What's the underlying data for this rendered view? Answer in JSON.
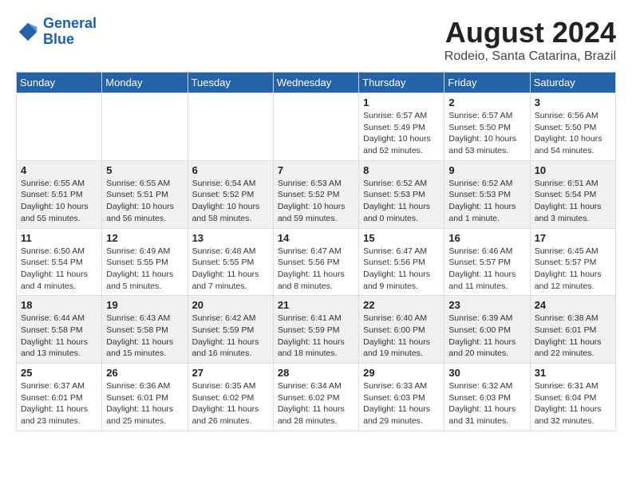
{
  "header": {
    "logo_line1": "General",
    "logo_line2": "Blue",
    "month_year": "August 2024",
    "location": "Rodeio, Santa Catarina, Brazil"
  },
  "weekdays": [
    "Sunday",
    "Monday",
    "Tuesday",
    "Wednesday",
    "Thursday",
    "Friday",
    "Saturday"
  ],
  "weeks": [
    [
      {
        "day": "",
        "sunrise": "",
        "sunset": "",
        "daylight": ""
      },
      {
        "day": "",
        "sunrise": "",
        "sunset": "",
        "daylight": ""
      },
      {
        "day": "",
        "sunrise": "",
        "sunset": "",
        "daylight": ""
      },
      {
        "day": "",
        "sunrise": "",
        "sunset": "",
        "daylight": ""
      },
      {
        "day": "1",
        "sunrise": "Sunrise: 6:57 AM",
        "sunset": "Sunset: 5:49 PM",
        "daylight": "Daylight: 10 hours and 52 minutes."
      },
      {
        "day": "2",
        "sunrise": "Sunrise: 6:57 AM",
        "sunset": "Sunset: 5:50 PM",
        "daylight": "Daylight: 10 hours and 53 minutes."
      },
      {
        "day": "3",
        "sunrise": "Sunrise: 6:56 AM",
        "sunset": "Sunset: 5:50 PM",
        "daylight": "Daylight: 10 hours and 54 minutes."
      }
    ],
    [
      {
        "day": "4",
        "sunrise": "Sunrise: 6:55 AM",
        "sunset": "Sunset: 5:51 PM",
        "daylight": "Daylight: 10 hours and 55 minutes."
      },
      {
        "day": "5",
        "sunrise": "Sunrise: 6:55 AM",
        "sunset": "Sunset: 5:51 PM",
        "daylight": "Daylight: 10 hours and 56 minutes."
      },
      {
        "day": "6",
        "sunrise": "Sunrise: 6:54 AM",
        "sunset": "Sunset: 5:52 PM",
        "daylight": "Daylight: 10 hours and 58 minutes."
      },
      {
        "day": "7",
        "sunrise": "Sunrise: 6:53 AM",
        "sunset": "Sunset: 5:52 PM",
        "daylight": "Daylight: 10 hours and 59 minutes."
      },
      {
        "day": "8",
        "sunrise": "Sunrise: 6:52 AM",
        "sunset": "Sunset: 5:53 PM",
        "daylight": "Daylight: 11 hours and 0 minutes."
      },
      {
        "day": "9",
        "sunrise": "Sunrise: 6:52 AM",
        "sunset": "Sunset: 5:53 PM",
        "daylight": "Daylight: 11 hours and 1 minute."
      },
      {
        "day": "10",
        "sunrise": "Sunrise: 6:51 AM",
        "sunset": "Sunset: 5:54 PM",
        "daylight": "Daylight: 11 hours and 3 minutes."
      }
    ],
    [
      {
        "day": "11",
        "sunrise": "Sunrise: 6:50 AM",
        "sunset": "Sunset: 5:54 PM",
        "daylight": "Daylight: 11 hours and 4 minutes."
      },
      {
        "day": "12",
        "sunrise": "Sunrise: 6:49 AM",
        "sunset": "Sunset: 5:55 PM",
        "daylight": "Daylight: 11 hours and 5 minutes."
      },
      {
        "day": "13",
        "sunrise": "Sunrise: 6:48 AM",
        "sunset": "Sunset: 5:55 PM",
        "daylight": "Daylight: 11 hours and 7 minutes."
      },
      {
        "day": "14",
        "sunrise": "Sunrise: 6:47 AM",
        "sunset": "Sunset: 5:56 PM",
        "daylight": "Daylight: 11 hours and 8 minutes."
      },
      {
        "day": "15",
        "sunrise": "Sunrise: 6:47 AM",
        "sunset": "Sunset: 5:56 PM",
        "daylight": "Daylight: 11 hours and 9 minutes."
      },
      {
        "day": "16",
        "sunrise": "Sunrise: 6:46 AM",
        "sunset": "Sunset: 5:57 PM",
        "daylight": "Daylight: 11 hours and 11 minutes."
      },
      {
        "day": "17",
        "sunrise": "Sunrise: 6:45 AM",
        "sunset": "Sunset: 5:57 PM",
        "daylight": "Daylight: 11 hours and 12 minutes."
      }
    ],
    [
      {
        "day": "18",
        "sunrise": "Sunrise: 6:44 AM",
        "sunset": "Sunset: 5:58 PM",
        "daylight": "Daylight: 11 hours and 13 minutes."
      },
      {
        "day": "19",
        "sunrise": "Sunrise: 6:43 AM",
        "sunset": "Sunset: 5:58 PM",
        "daylight": "Daylight: 11 hours and 15 minutes."
      },
      {
        "day": "20",
        "sunrise": "Sunrise: 6:42 AM",
        "sunset": "Sunset: 5:59 PM",
        "daylight": "Daylight: 11 hours and 16 minutes."
      },
      {
        "day": "21",
        "sunrise": "Sunrise: 6:41 AM",
        "sunset": "Sunset: 5:59 PM",
        "daylight": "Daylight: 11 hours and 18 minutes."
      },
      {
        "day": "22",
        "sunrise": "Sunrise: 6:40 AM",
        "sunset": "Sunset: 6:00 PM",
        "daylight": "Daylight: 11 hours and 19 minutes."
      },
      {
        "day": "23",
        "sunrise": "Sunrise: 6:39 AM",
        "sunset": "Sunset: 6:00 PM",
        "daylight": "Daylight: 11 hours and 20 minutes."
      },
      {
        "day": "24",
        "sunrise": "Sunrise: 6:38 AM",
        "sunset": "Sunset: 6:01 PM",
        "daylight": "Daylight: 11 hours and 22 minutes."
      }
    ],
    [
      {
        "day": "25",
        "sunrise": "Sunrise: 6:37 AM",
        "sunset": "Sunset: 6:01 PM",
        "daylight": "Daylight: 11 hours and 23 minutes."
      },
      {
        "day": "26",
        "sunrise": "Sunrise: 6:36 AM",
        "sunset": "Sunset: 6:01 PM",
        "daylight": "Daylight: 11 hours and 25 minutes."
      },
      {
        "day": "27",
        "sunrise": "Sunrise: 6:35 AM",
        "sunset": "Sunset: 6:02 PM",
        "daylight": "Daylight: 11 hours and 26 minutes."
      },
      {
        "day": "28",
        "sunrise": "Sunrise: 6:34 AM",
        "sunset": "Sunset: 6:02 PM",
        "daylight": "Daylight: 11 hours and 28 minutes."
      },
      {
        "day": "29",
        "sunrise": "Sunrise: 6:33 AM",
        "sunset": "Sunset: 6:03 PM",
        "daylight": "Daylight: 11 hours and 29 minutes."
      },
      {
        "day": "30",
        "sunrise": "Sunrise: 6:32 AM",
        "sunset": "Sunset: 6:03 PM",
        "daylight": "Daylight: 11 hours and 31 minutes."
      },
      {
        "day": "31",
        "sunrise": "Sunrise: 6:31 AM",
        "sunset": "Sunset: 6:04 PM",
        "daylight": "Daylight: 11 hours and 32 minutes."
      }
    ]
  ]
}
